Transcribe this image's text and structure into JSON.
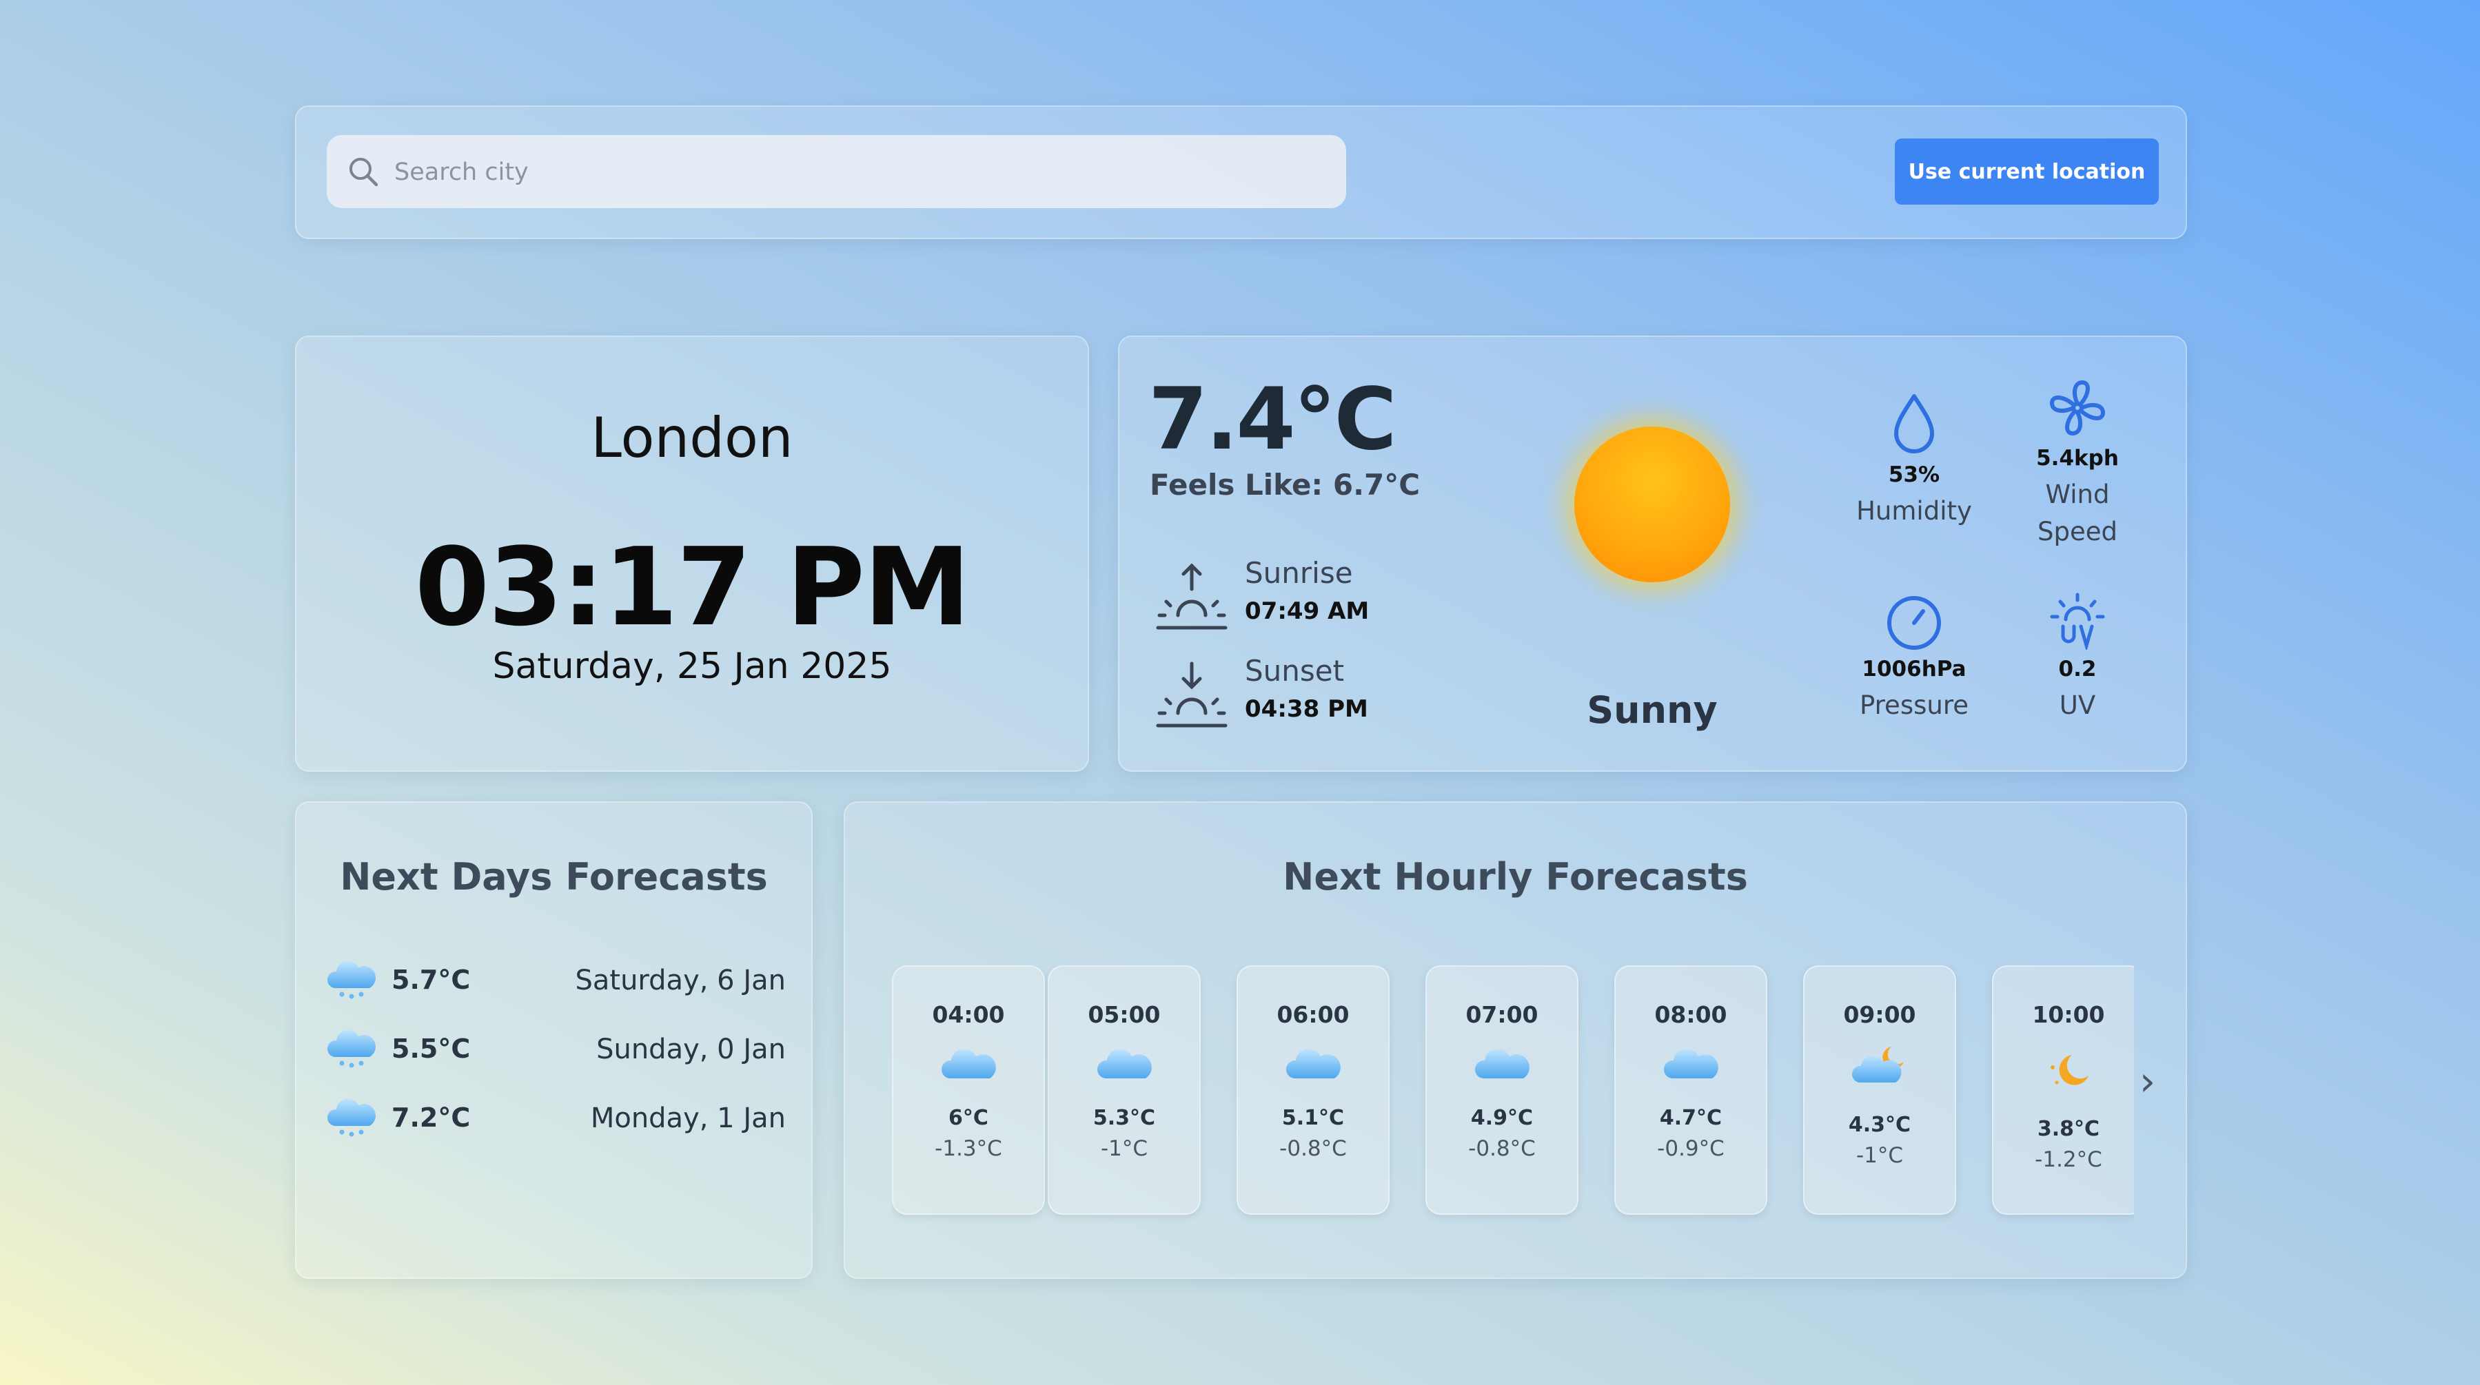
{
  "search": {
    "placeholder": "Search city",
    "button_label": "Use current location"
  },
  "city": {
    "name": "London",
    "time": "03:17 PM",
    "date": "Saturday, 25 Jan 2025"
  },
  "current": {
    "temperature": "7.4°C",
    "feels_like": "Feels Like: 6.7°C",
    "sunrise": {
      "label": "Sunrise",
      "time": "07:49 AM"
    },
    "sunset": {
      "label": "Sunset",
      "time": "04:38 PM"
    },
    "condition": "Sunny",
    "humidity": {
      "value": "53%",
      "label": "Humidity"
    },
    "wind": {
      "value": "5.4kph",
      "label": "Wind Speed"
    },
    "pressure": {
      "value": "1006hPa",
      "label": "Pressure"
    },
    "uv": {
      "value": "0.2",
      "label": "UV"
    }
  },
  "daily": {
    "title": "Next Days Forecasts",
    "days": [
      {
        "temp": "5.7°C",
        "date": "Saturday, 6 Jan",
        "icon": "cloud-snow-icon"
      },
      {
        "temp": "5.5°C",
        "date": "Sunday, 0 Jan",
        "icon": "cloud-snow-icon"
      },
      {
        "temp": "7.2°C",
        "date": "Monday, 1 Jan",
        "icon": "cloud-snow-icon"
      }
    ]
  },
  "hourly": {
    "title": "Next Hourly Forecasts",
    "hours": [
      {
        "time": "04:00",
        "temp": "6°C",
        "feels": "-1.3°C",
        "icon": "cloud-icon"
      },
      {
        "time": "05:00",
        "temp": "5.3°C",
        "feels": "-1°C",
        "icon": "cloud-icon"
      },
      {
        "time": "06:00",
        "temp": "5.1°C",
        "feels": "-0.8°C",
        "icon": "cloud-icon"
      },
      {
        "time": "07:00",
        "temp": "4.9°C",
        "feels": "-0.8°C",
        "icon": "cloud-icon"
      },
      {
        "time": "08:00",
        "temp": "4.7°C",
        "feels": "-0.9°C",
        "icon": "cloud-icon"
      },
      {
        "time": "09:00",
        "temp": "4.3°C",
        "feels": "-1°C",
        "icon": "cloud-moon-icon"
      },
      {
        "time": "10:00",
        "temp": "3.8°C",
        "feels": "-1.2°C",
        "icon": "moon-icon"
      }
    ],
    "next_arrow": "›"
  },
  "colors": {
    "accent": "#3d85f3",
    "icon_blue": "#2f6fe0",
    "sun": "#ffa80c"
  }
}
